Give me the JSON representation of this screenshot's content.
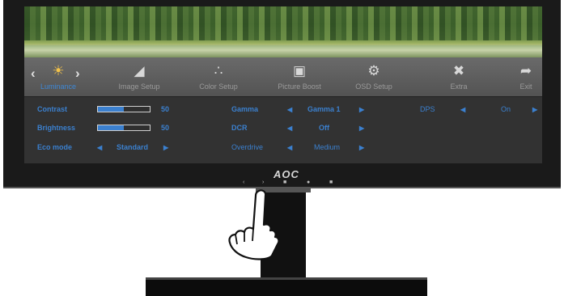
{
  "brand": "AOC",
  "tabs": [
    {
      "label": "Luminance",
      "icon": "sun-icon",
      "active": true
    },
    {
      "label": "Image Setup",
      "icon": "image-setup-icon"
    },
    {
      "label": "Color Setup",
      "icon": "color-setup-icon"
    },
    {
      "label": "Picture Boost",
      "icon": "picture-boost-icon"
    },
    {
      "label": "OSD Setup",
      "icon": "osd-setup-icon"
    },
    {
      "label": "Extra",
      "icon": "tools-icon"
    },
    {
      "label": "Exit",
      "icon": "exit-icon"
    }
  ],
  "luminance": {
    "contrast": {
      "label": "Contrast",
      "value": "50",
      "level": 0.5
    },
    "brightness": {
      "label": "Brightness",
      "value": "50",
      "level": 0.5
    },
    "eco_mode": {
      "label": "Eco mode",
      "value": "Standard"
    },
    "gamma": {
      "label": "Gamma",
      "value": "Gamma 1"
    },
    "dcr": {
      "label": "DCR",
      "value": "Off"
    },
    "overdrive": {
      "label": "Overdrive",
      "value": "Medium"
    },
    "dps": {
      "label": "DPS",
      "value": "On"
    }
  },
  "colors": {
    "accent": "#3b80cf",
    "active_icon": "#f4c34a",
    "osd_bg": "#323232"
  }
}
